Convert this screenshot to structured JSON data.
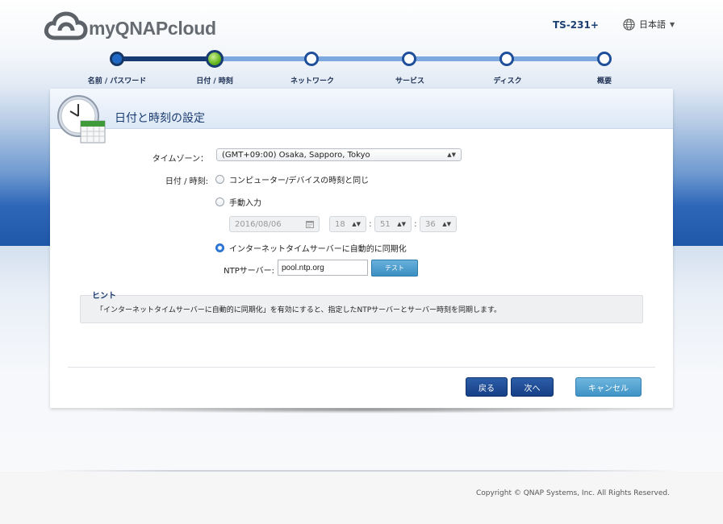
{
  "header": {
    "logo_text": "myQNAPcloud",
    "model": "TS-231+",
    "language": "日本語"
  },
  "steps": [
    {
      "label": "名前 / パスワード",
      "state": "done"
    },
    {
      "label": "日付 / 時刻",
      "state": "active"
    },
    {
      "label": "ネットワーク",
      "state": "pending"
    },
    {
      "label": "サービス",
      "state": "pending"
    },
    {
      "label": "ディスク",
      "state": "pending"
    },
    {
      "label": "概要",
      "state": "pending"
    }
  ],
  "panel": {
    "title": "日付と時刻の設定",
    "timezone_label": "タイムゾーン：",
    "timezone_value": "(GMT+09:00) Osaka, Sapporo, Tokyo",
    "datetime_label": "日付 / 時刻:",
    "option_sync_computer": "コンピューター/デバイスの時刻と同じ",
    "option_manual": "手動入力",
    "manual_date": "2016/08/06",
    "manual_hour": "18",
    "manual_minute": "51",
    "manual_second": "36",
    "option_ntp": "インターネットタイムサーバーに自動的に同期化",
    "selected_option": "ntp",
    "ntp_label": "NTPサーバー:",
    "ntp_value": "pool.ntp.org",
    "test_button": "テスト",
    "hint_title": "ヒント",
    "hint_text": "「インターネットタイムサーバーに自動的に同期化」を有効にすると、指定したNTPサーバーとサーバー時刻を同期します。"
  },
  "buttons": {
    "back": "戻る",
    "next": "次へ",
    "cancel": "キャンセル"
  },
  "footer": {
    "copyright": "Copyright © QNAP Systems, Inc. All Rights Reserved."
  },
  "colors": {
    "primary_dark": "#173a73",
    "accent_blue": "#3f93c5",
    "active_step": "#63b41d"
  }
}
